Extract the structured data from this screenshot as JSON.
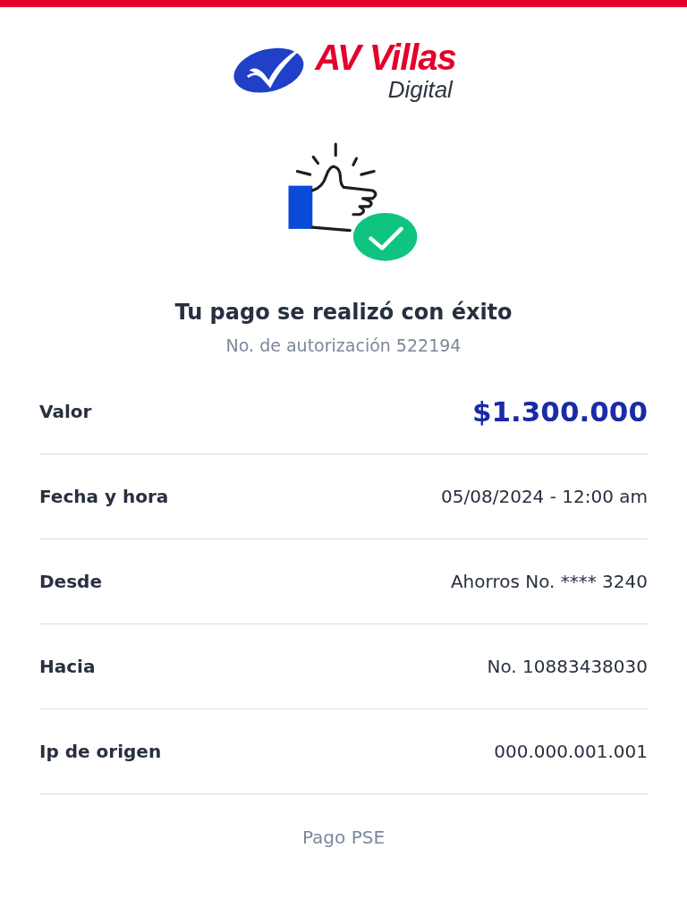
{
  "logo": {
    "name": "AV Villas",
    "tagline": "Digital"
  },
  "title": "Tu pago se realizó con éxito",
  "subtitle": "No. de autorización 522194",
  "details": [
    {
      "label": "Valor",
      "value": "$1.300.000",
      "kind": "amount"
    },
    {
      "label": "Fecha y hora",
      "value": "05/08/2024 - 12:00 am",
      "kind": "plain"
    },
    {
      "label": "Desde",
      "value": "Ahorros No. **** 3240",
      "kind": "plain"
    },
    {
      "label": "Hacia",
      "value": "No. 10883438030",
      "kind": "plain"
    },
    {
      "label": "Ip de origen",
      "value": "000.000.001.001",
      "kind": "plain"
    }
  ],
  "footer": "Pago PSE"
}
